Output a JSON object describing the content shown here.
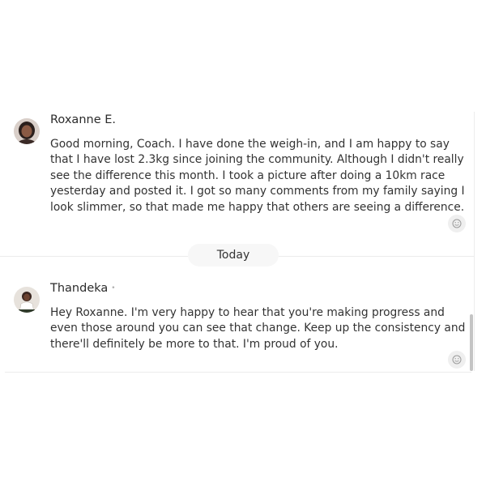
{
  "messages": [
    {
      "author": "Roxanne E.",
      "text": "Good morning, Coach. I have done the weigh-in, and I am happy to say\nthat I have lost 2.3kg since joining the community. Although I didn't really\nsee the difference this month. I took a picture after doing a 10km race\nyesterday and posted it. I got so many comments from my family saying I\nlook slimmer, so that made me happy that others are seeing a difference."
    },
    {
      "author": "Thandeka",
      "text": "Hey Roxanne. I'm very happy to hear that you're making progress and\neven those around you can see that change. Keep up the consistency and\nthere'll definitely be more to that. I'm proud of you."
    }
  ],
  "date_divider": "Today",
  "icons": {
    "reaction": "smiley-icon"
  },
  "colors": {
    "text": "#333333",
    "divider": "#ececec",
    "pill_bg": "#f7f7f7",
    "react_bg": "#efefef"
  }
}
